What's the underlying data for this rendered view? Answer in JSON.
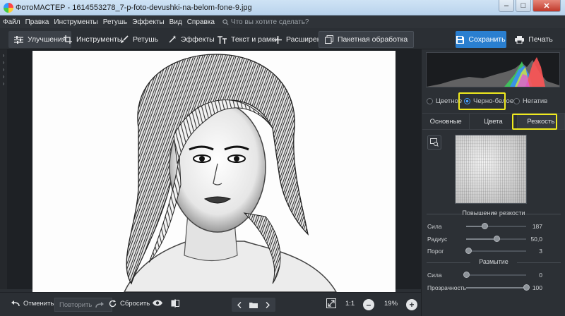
{
  "window": {
    "title": "ФотоМАСТЕР - 1614553278_7-p-foto-devushki-na-belom-fone-9.jpg",
    "controls": [
      "–",
      "□",
      "✕"
    ]
  },
  "menu": {
    "items": [
      "Файл",
      "Правка",
      "Инструменты",
      "Ретушь",
      "Эффекты",
      "Вид",
      "Справка"
    ],
    "search_placeholder": "Что вы хотите сделать?"
  },
  "toolbar": {
    "tabs": [
      "Улучшения",
      "Инструменты",
      "Ретушь",
      "Эффекты",
      "Текст и рамки",
      "Расширения",
      "Пакетная обработка"
    ],
    "active_tab": "Улучшения",
    "save_label": "Сохранить",
    "print_label": "Печать"
  },
  "panel": {
    "modes": [
      "Цветное",
      "Черно-белое",
      "Негатив"
    ],
    "selected_mode": "Черно-белое",
    "subtabs": [
      "Основные",
      "Цвета",
      "Резкость"
    ],
    "active_subtab": "Резкость",
    "sharpen_title": "Повышение резкости",
    "sharpen": [
      {
        "label": "Сила",
        "value": "187",
        "level": 0.31
      },
      {
        "label": "Радиус",
        "value": "50,0",
        "level": 0.5
      },
      {
        "label": "Порог",
        "value": "3",
        "level": 0.03
      }
    ],
    "blur_title": "Размытие",
    "blur": [
      {
        "label": "Сила",
        "value": "0",
        "level": 0.0
      },
      {
        "label": "Прозрачность",
        "value": "100",
        "level": 1.0
      }
    ],
    "highlight_color": "#f0ea1e"
  },
  "bottom": {
    "undo_label": "Отменить",
    "redo_label": "Повторить",
    "reset_label": "Сбросить",
    "zoom_ratio": "1:1",
    "zoom_percent": "19%"
  },
  "colors": {
    "accent": "#2a7fd0",
    "highlight": "#f0ea1e"
  }
}
